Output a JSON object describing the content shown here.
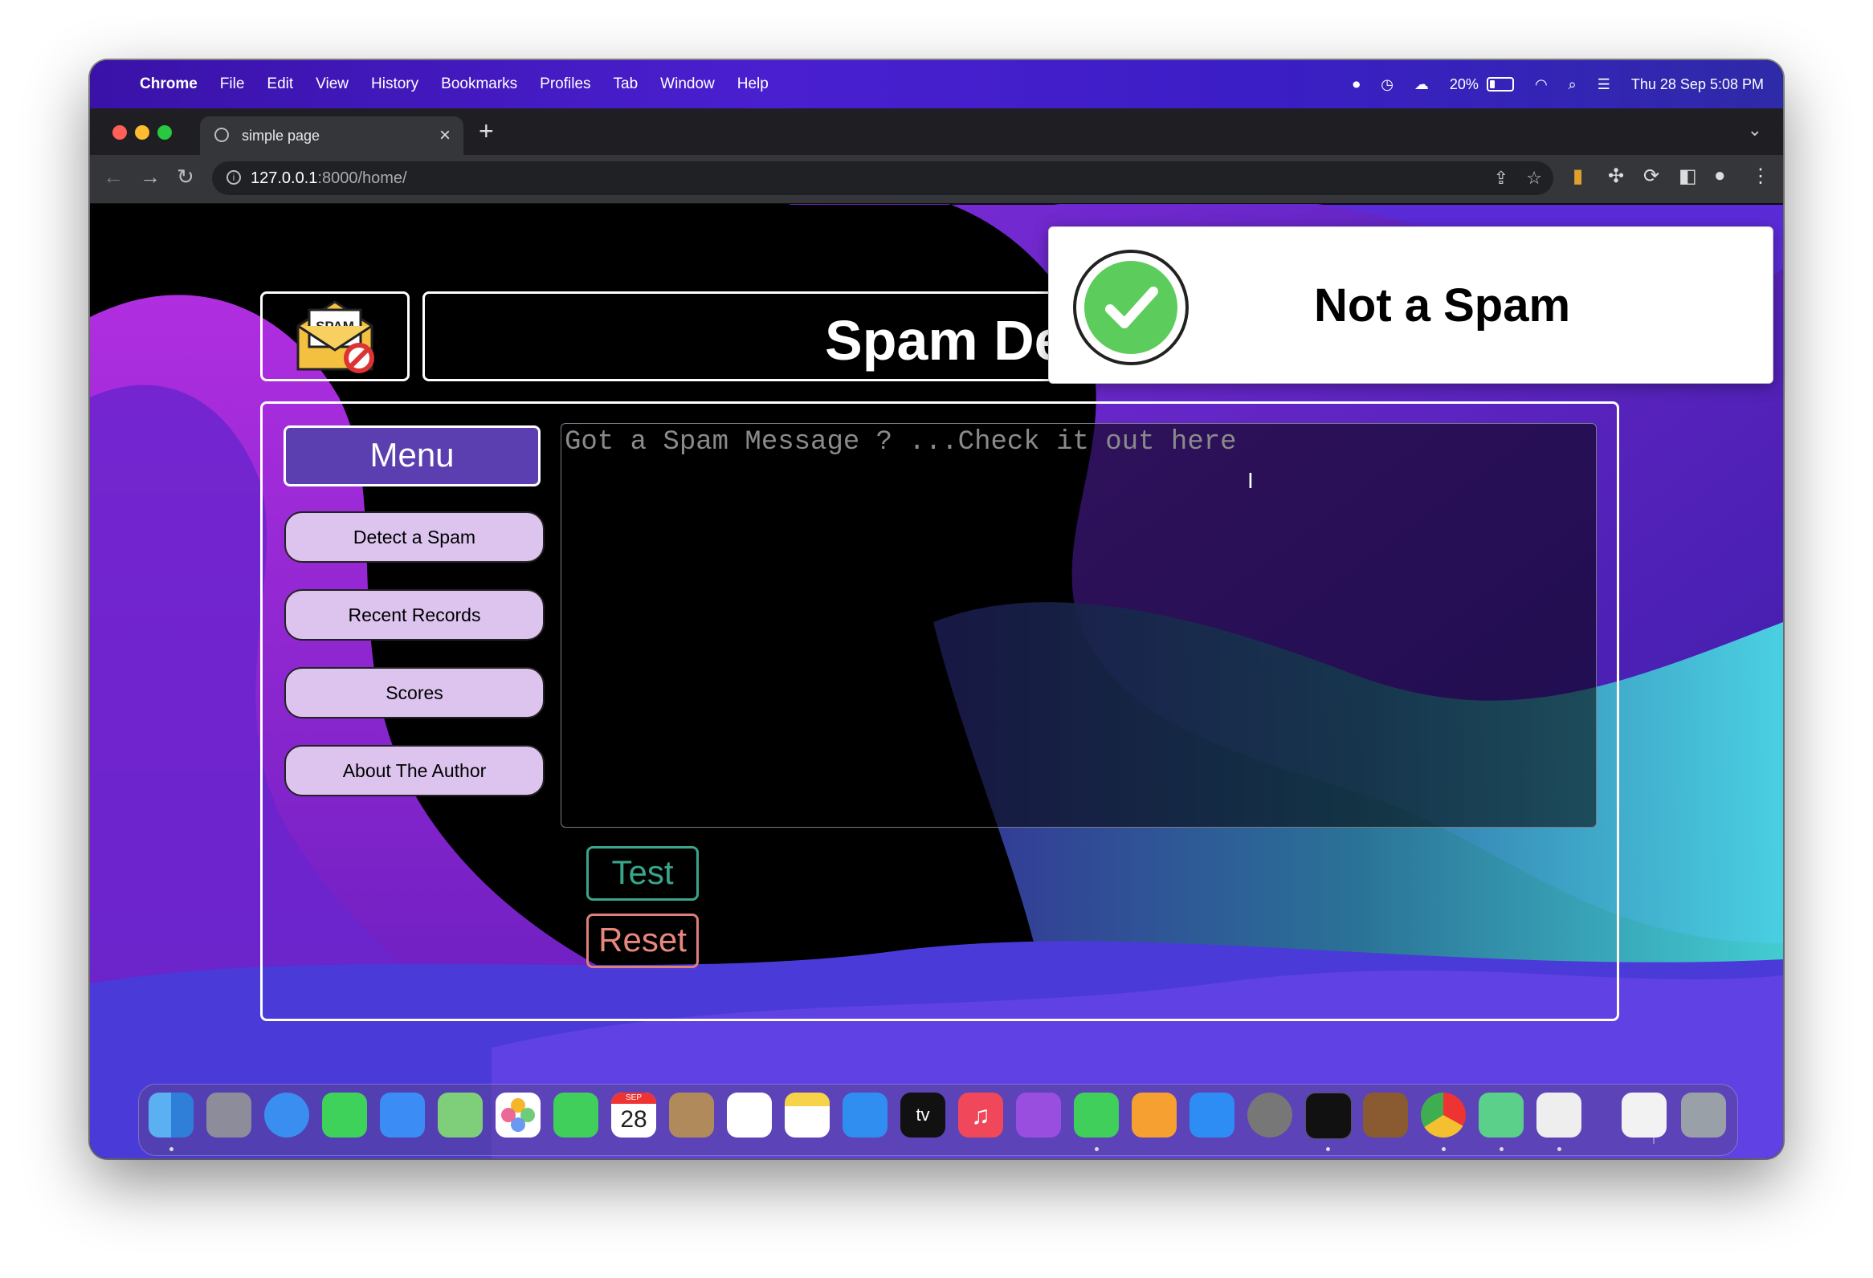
{
  "menubar": {
    "app": "Chrome",
    "items": [
      "File",
      "Edit",
      "View",
      "History",
      "Bookmarks",
      "Profiles",
      "Tab",
      "Window",
      "Help"
    ],
    "battery": "20%",
    "datetime": "Thu 28 Sep  5:08 PM"
  },
  "browser": {
    "tab_title": "simple page",
    "url_host": "127.0.0.1",
    "url_path": ":8000/home/"
  },
  "page": {
    "logo_text": "SPAM",
    "title": "Spam Detector",
    "menu_title": "Menu",
    "menu_items": [
      "Detect a Spam",
      "Recent Records",
      "Scores",
      "About The Author"
    ],
    "message_placeholder": "Got a Spam Message ? ...Check it out here",
    "test_label": "Test",
    "reset_label": "Reset"
  },
  "toast": {
    "text": "Not a Spam",
    "color": "#5ccd5c"
  },
  "dock": {
    "calendar_month": "SEP",
    "calendar_day": "28",
    "tv_label": "tv"
  },
  "colors": {
    "menu_header": "#5b3fb0",
    "menu_item": "#dcc4ef",
    "test": "#3aa58a",
    "reset": "#e07f79"
  }
}
